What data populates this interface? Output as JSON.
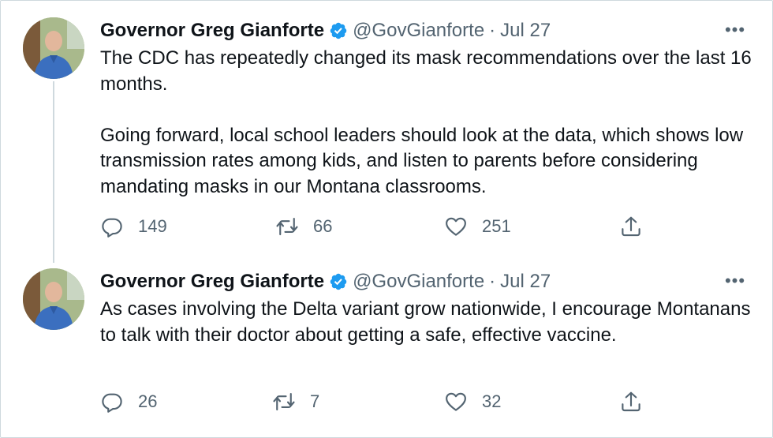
{
  "tweets": [
    {
      "display_name": "Governor Greg Gianforte",
      "handle": "@GovGianforte",
      "separator": "·",
      "date": "Jul 27",
      "more": "•••",
      "paragraphs": [
        "The CDC has repeatedly changed its mask recommendations over the last 16 months.",
        "Going forward, local school leaders should look at the data, which shows low transmission rates among kids, and listen to parents before considering mandating masks in our Montana classrooms."
      ],
      "replies": "149",
      "retweets": "66",
      "likes": "251"
    },
    {
      "display_name": "Governor Greg Gianforte",
      "handle": "@GovGianforte",
      "separator": "·",
      "date": "Jul 27",
      "more": "•••",
      "paragraphs": [
        "As cases involving the Delta variant grow nationwide, I encourage Montanans to talk with their doctor about getting a safe, effective vaccine."
      ],
      "replies": "26",
      "retweets": "7",
      "likes": "32"
    }
  ],
  "icons": {
    "verified": "verified-badge-icon",
    "reply": "reply-icon",
    "retweet": "retweet-icon",
    "like": "heart-icon",
    "share": "share-icon"
  },
  "colors": {
    "verified": "#1d9bf0",
    "text": "#0f1419",
    "muted": "#536471",
    "border": "#cfd9de"
  }
}
